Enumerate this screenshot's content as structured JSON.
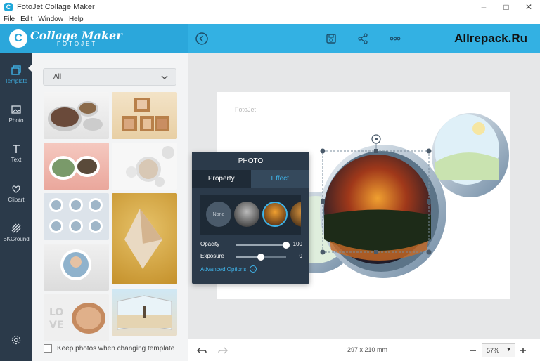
{
  "window": {
    "title": "FotoJet Collage Maker"
  },
  "menu": [
    "File",
    "Edit",
    "Window",
    "Help"
  ],
  "header": {
    "logo_line1": "Collage Maker",
    "logo_line2": "FOTOJET",
    "watermark": "Allrepack.Ru"
  },
  "sidebar": {
    "items": [
      {
        "label": "Template",
        "icon": "template-icon",
        "active": true
      },
      {
        "label": "Photo",
        "icon": "photo-icon"
      },
      {
        "label": "Text",
        "icon": "text-icon"
      },
      {
        "label": "Clipart",
        "icon": "heart-icon"
      },
      {
        "label": "BKGround",
        "icon": "background-icon"
      }
    ]
  },
  "panel": {
    "category": "All",
    "keep_photos_label": "Keep photos when changing template",
    "thumbnail_count": 10
  },
  "canvas": {
    "page_label": "FotoJet",
    "dimensions": "297 x 210 mm",
    "zoom": "57%"
  },
  "photo_popup": {
    "title": "PHOTO",
    "tabs": [
      "Property",
      "Effect"
    ],
    "active_tab": "Effect",
    "filter_none_label": "None",
    "sliders": [
      {
        "name": "Opacity",
        "value": "100",
        "level": 1.0
      },
      {
        "name": "Exposure",
        "value": "0",
        "level": 0.5
      }
    ],
    "advanced_label": "Advanced Options"
  },
  "colors": {
    "accent": "#2ba7db",
    "sidebar": "#2b3a4a",
    "active": "#3fb3e8"
  }
}
